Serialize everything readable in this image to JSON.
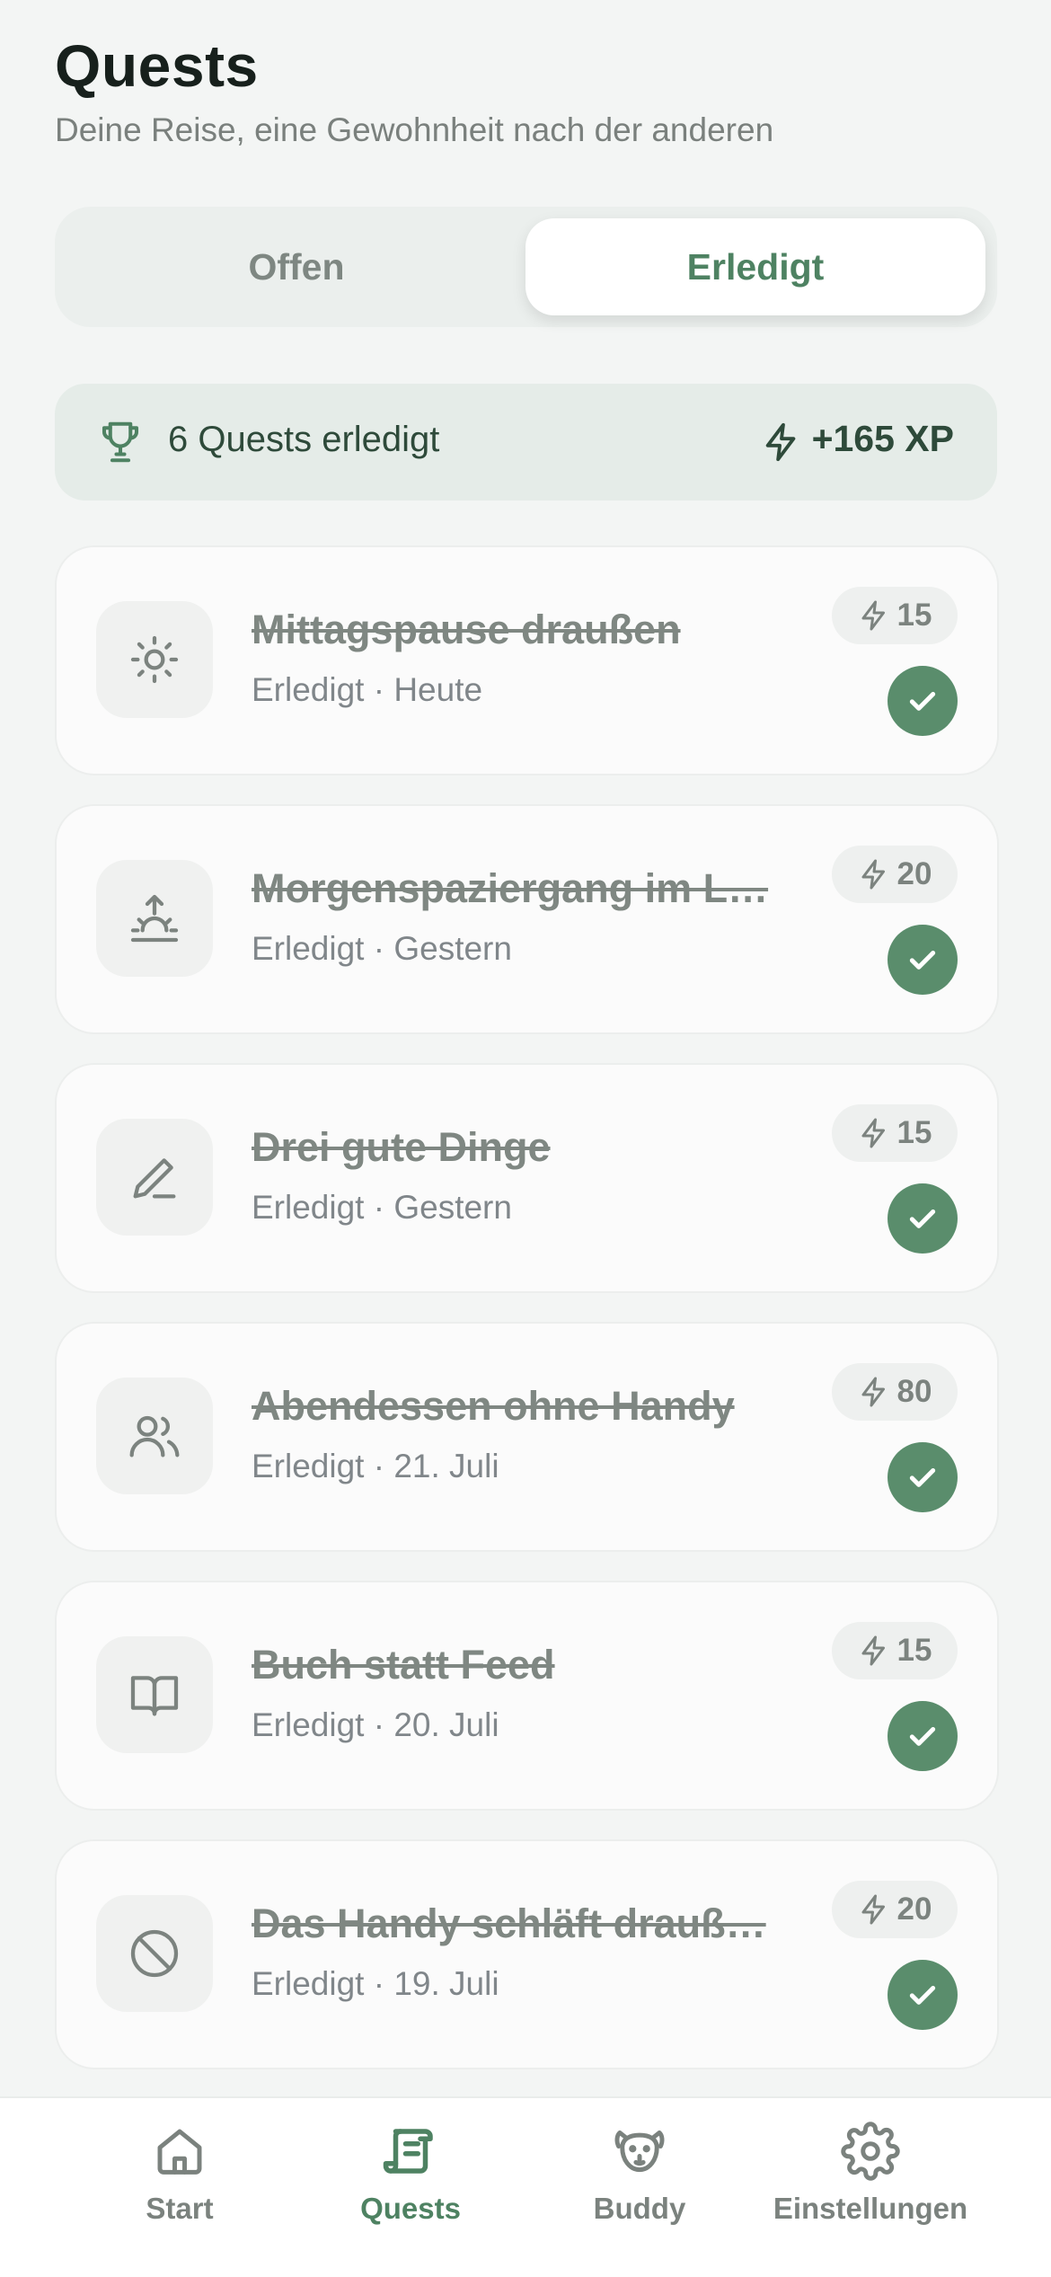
{
  "header": {
    "title": "Quests",
    "subtitle": "Deine Reise, eine Gewohnheit nach der anderen"
  },
  "tabs": {
    "open_label": "Offen",
    "done_label": "Erledigt",
    "active": "done"
  },
  "summary": {
    "icon": "trophy-icon",
    "text": "6 Quests erledigt",
    "xp_icon": "bolt-icon",
    "xp": "+165 XP"
  },
  "quests": [
    {
      "icon": "sun-icon",
      "title": "Mittagspause draußen",
      "meta": "Erledigt · Heute",
      "xp": "15",
      "completed": true
    },
    {
      "icon": "sunrise-icon",
      "title": "Morgenspaziergang im L…",
      "meta": "Erledigt · Gestern",
      "xp": "20",
      "completed": true
    },
    {
      "icon": "pencil-icon",
      "title": "Drei gute Dinge",
      "meta": "Erledigt · Gestern",
      "xp": "15",
      "completed": true
    },
    {
      "icon": "users-icon",
      "title": "Abendessen ohne Handy",
      "meta": "Erledigt · 21. Juli",
      "xp": "80",
      "completed": true
    },
    {
      "icon": "book-icon",
      "title": "Buch statt Feed",
      "meta": "Erledigt · 20. Juli",
      "xp": "15",
      "completed": true
    },
    {
      "icon": "ban-icon",
      "title": "Das Handy schläft drauß…",
      "meta": "Erledigt · 19. Juli",
      "xp": "20",
      "completed": true
    }
  ],
  "nav": {
    "items": [
      {
        "label": "Start",
        "icon": "home-icon"
      },
      {
        "label": "Quests",
        "icon": "scroll-icon"
      },
      {
        "label": "Buddy",
        "icon": "dog-icon"
      },
      {
        "label": "Einstellungen",
        "icon": "gear-icon"
      }
    ],
    "active": "Quests"
  },
  "colors": {
    "accent": "#5A8D6C",
    "accent_text": "#4E8262",
    "background": "#F3F5F4",
    "summary_bg": "#E5ECE8"
  }
}
